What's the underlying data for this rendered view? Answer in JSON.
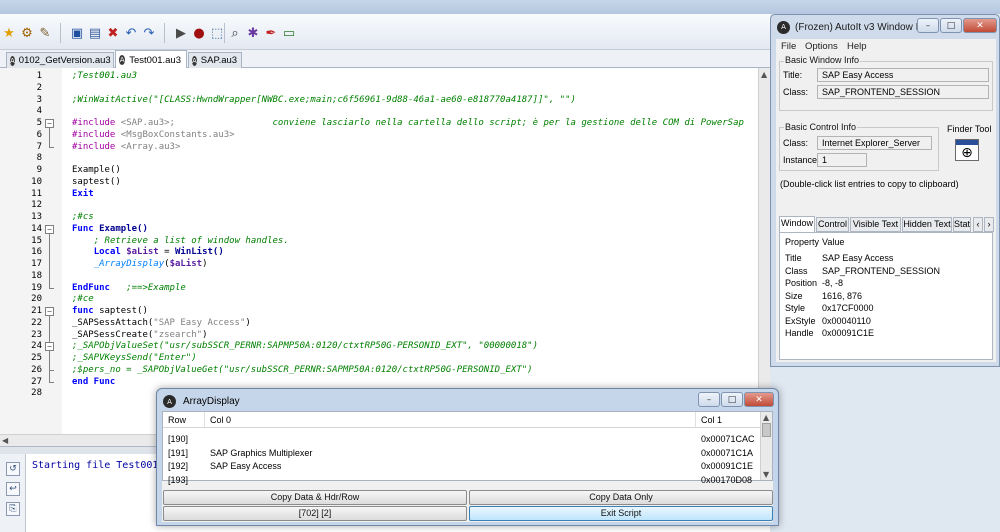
{
  "editor": {
    "tabs": [
      "0102_GetVersion.au3",
      "Test001.au3",
      "SAP.au3"
    ],
    "active_tab": 1,
    "code_lines": [
      {
        "n": "1",
        "segs": [
          {
            "c": "c-cmt",
            "t": ";Test001.au3"
          }
        ]
      },
      {
        "n": "2",
        "segs": []
      },
      {
        "n": "3",
        "segs": [
          {
            "c": "c-cmt",
            "t": ";WinWaitActive(\"[CLASS:HwndWrapper[NWBC.exe;main;c6f56961-9d88-46a1-ae60-e818770a4187]]\", \"\")"
          }
        ]
      },
      {
        "n": "4",
        "segs": []
      },
      {
        "n": "5",
        "segs": [
          {
            "c": "c-inc",
            "t": "#include "
          },
          {
            "c": "c-str",
            "t": "<SAP.au3>;"
          },
          {
            "c": "c-def",
            "t": "                  "
          },
          {
            "c": "c-cmt",
            "t": "conviene lasciarlo nella cartella dello script; è per la gestione delle COM di PowerSap"
          }
        ]
      },
      {
        "n": "6",
        "segs": [
          {
            "c": "c-inc",
            "t": "#include "
          },
          {
            "c": "c-str",
            "t": "<MsgBoxConstants.au3>"
          }
        ]
      },
      {
        "n": "7",
        "segs": [
          {
            "c": "c-inc",
            "t": "#include "
          },
          {
            "c": "c-str",
            "t": "<Array.au3>"
          }
        ]
      },
      {
        "n": "8",
        "segs": []
      },
      {
        "n": "9",
        "segs": [
          {
            "c": "c-def",
            "t": "Example"
          },
          {
            "c": "c-def",
            "t": "()"
          }
        ]
      },
      {
        "n": "10",
        "segs": [
          {
            "c": "c-def",
            "t": "saptest()"
          }
        ]
      },
      {
        "n": "11",
        "segs": [
          {
            "c": "c-kw",
            "t": "Exit"
          }
        ]
      },
      {
        "n": "12",
        "segs": []
      },
      {
        "n": "13",
        "segs": [
          {
            "c": "c-cmt",
            "t": ";#cs"
          }
        ]
      },
      {
        "n": "14",
        "segs": [
          {
            "c": "c-kw",
            "t": "Func "
          },
          {
            "c": "c-fn",
            "t": "Example()"
          }
        ]
      },
      {
        "n": "15",
        "segs": [
          {
            "c": "c-def",
            "t": "    "
          },
          {
            "c": "c-cmt",
            "t": "; Retrieve a list of window handles."
          }
        ]
      },
      {
        "n": "16",
        "segs": [
          {
            "c": "c-def",
            "t": "    "
          },
          {
            "c": "c-kw",
            "t": "Local "
          },
          {
            "c": "c-var",
            "t": "$aList"
          },
          {
            "c": "c-def",
            "t": " = "
          },
          {
            "c": "c-fn",
            "t": "WinList()"
          }
        ]
      },
      {
        "n": "17",
        "segs": [
          {
            "c": "c-def",
            "t": "    "
          },
          {
            "c": "c-lib",
            "t": "_ArrayDisplay"
          },
          {
            "c": "c-def",
            "t": "("
          },
          {
            "c": "c-var",
            "t": "$aList"
          },
          {
            "c": "c-def",
            "t": ")"
          }
        ]
      },
      {
        "n": "18",
        "segs": []
      },
      {
        "n": "19",
        "segs": [
          {
            "c": "c-kw",
            "t": "EndFunc"
          },
          {
            "c": "c-def",
            "t": "   "
          },
          {
            "c": "c-cmt",
            "t": ";==>Example"
          }
        ]
      },
      {
        "n": "20",
        "segs": [
          {
            "c": "c-cmt",
            "t": ";#ce"
          }
        ]
      },
      {
        "n": "21",
        "segs": [
          {
            "c": "c-kw",
            "t": "func "
          },
          {
            "c": "c-def",
            "t": "saptest()"
          }
        ]
      },
      {
        "n": "22",
        "segs": [
          {
            "c": "c-def",
            "t": "_SAPSessAttach("
          },
          {
            "c": "c-str",
            "t": "\"SAP Easy Access\""
          },
          {
            "c": "c-def",
            "t": ")"
          }
        ]
      },
      {
        "n": "23",
        "segs": [
          {
            "c": "c-def",
            "t": "_SAPSessCreate("
          },
          {
            "c": "c-str",
            "t": "\"zsearch\""
          },
          {
            "c": "c-def",
            "t": ")"
          }
        ]
      },
      {
        "n": "24",
        "segs": [
          {
            "c": "c-cmt",
            "t": ";_SAPObjValueSet(\"usr/subSSCR_PERNR:SAPMP50A:0120/ctxtRP50G-PERSONID_EXT\", \"00000018\")"
          }
        ]
      },
      {
        "n": "25",
        "segs": [
          {
            "c": "c-cmt",
            "t": ";_SAPVKeysSend(\"Enter\")"
          }
        ]
      },
      {
        "n": "26",
        "segs": [
          {
            "c": "c-cmt",
            "t": ";$pers_no = _SAPObjValueGet(\"usr/subSSCR_PERNR:SAPMP50A:0120/ctxtRP50G-PERSONID_EXT\")"
          }
        ]
      },
      {
        "n": "27",
        "segs": [
          {
            "c": "c-kw",
            "t": "end Func"
          }
        ]
      },
      {
        "n": "28",
        "segs": []
      }
    ],
    "output_text": "Starting file Test001"
  },
  "winfo": {
    "title": "(Frozen) AutoIt v3 Window Info",
    "menu": [
      "File",
      "Options",
      "Help"
    ],
    "basic_window_label": "Basic Window Info",
    "title_label": "Title:",
    "title_value": "SAP Easy Access",
    "class_label": "Class:",
    "class_value": "SAP_FRONTEND_SESSION",
    "basic_control_label": "Basic Control Info",
    "control_class_label": "Class:",
    "control_class_value": "Internet Explorer_Server",
    "instance_label": "Instance:",
    "instance_value": "1",
    "finder_label": "Finder Tool",
    "hint": "(Double-click list entries to copy to clipboard)",
    "tabs": [
      "Window",
      "Control",
      "Visible Text",
      "Hidden Text",
      "Stat"
    ],
    "prop_header": "Property",
    "value_header": "Value",
    "props": [
      {
        "k": "Title",
        "v": "SAP Easy Access"
      },
      {
        "k": "Class",
        "v": "SAP_FRONTEND_SESSION"
      },
      {
        "k": "Position",
        "v": "-8, -8"
      },
      {
        "k": "Size",
        "v": "1616, 876"
      },
      {
        "k": "Style",
        "v": "0x17CF0000"
      },
      {
        "k": "ExStyle",
        "v": "0x00040110"
      },
      {
        "k": "Handle",
        "v": "0x00091C1E"
      }
    ]
  },
  "arraydisplay": {
    "title": "ArrayDisplay",
    "headers": [
      "Row",
      "Col 0",
      "Col 1"
    ],
    "rows": [
      [
        "[190]",
        "",
        "0x00071CAC"
      ],
      [
        "[191]",
        "SAP Graphics Multiplexer",
        "0x00071C1A"
      ],
      [
        "[192]",
        "SAP Easy Access",
        "0x00091C1E"
      ],
      [
        "[193]",
        "",
        "0x00170D08"
      ]
    ],
    "btn_copy_hdr": "Copy Data & Hdr/Row",
    "btn_copy_only": "Copy Data Only",
    "dims": "[702] [2]",
    "btn_exit": "Exit Script"
  }
}
